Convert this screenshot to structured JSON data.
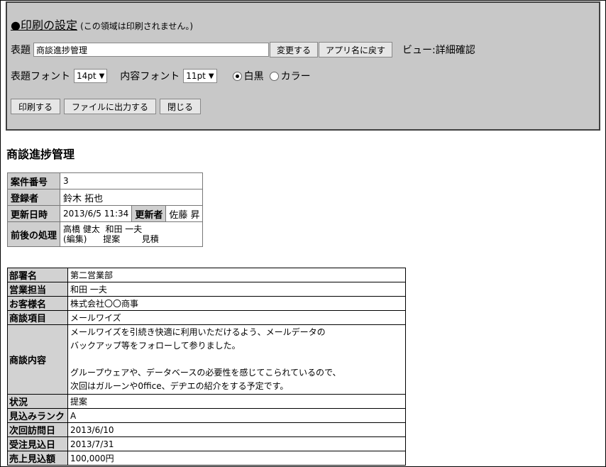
{
  "print_settings": {
    "heading_link": "●印刷の設定",
    "heading_note": "(この領域は印刷されません。)",
    "title_label": "表題",
    "title_value": "商談進捗管理",
    "change_button": "変更する",
    "reset_button": "アプリ名に戻す",
    "view_label": "ビュー:詳細確認",
    "title_font_label": "表題フォント",
    "title_font_value": "14pt",
    "content_font_label": "内容フォント",
    "content_font_value": "11pt",
    "mono_label": "白黒",
    "color_label": "カラー",
    "print_button": "印刷する",
    "export_button": "ファイルに出力する",
    "close_button": "閉じる"
  },
  "page_title": "商談進捗管理",
  "record_info": {
    "case_no_label": "案件番号",
    "case_no": "3",
    "registrant_label": "登録者",
    "registrant": "鈴木 拓也",
    "updated_at_label": "更新日時",
    "updated_at": "2013/6/5 11:34",
    "updater_label": "更新者",
    "updater": "佐藤 昇",
    "process_label": "前後の処理",
    "process_value": "高橋 健太  和田 一夫\n(編集)      提案        見積"
  },
  "details": [
    {
      "label": "部署名",
      "value": "第二営業部"
    },
    {
      "label": "営業担当",
      "value": "和田 一夫"
    },
    {
      "label": "お客様名",
      "value": "株式会社〇〇商事"
    },
    {
      "label": "商談項目",
      "value": "メールワイズ"
    },
    {
      "label": "商談内容",
      "value": "メールワイズを引続き快適に利用いただけるよう、メールデータの\nバックアップ等をフォローして参りました。\n\nグループウェアや、データベースの必要性を感じてこられているので、\n次回はガルーンや0ffice、デヂエの紹介をする予定です。"
    },
    {
      "label": "状況",
      "value": "提案"
    },
    {
      "label": "見込みランク",
      "value": "A"
    },
    {
      "label": "次回訪問日",
      "value": "2013/6/10"
    },
    {
      "label": "受注見込日",
      "value": "2013/7/31"
    },
    {
      "label": "売上見込額",
      "value": "100,000円"
    }
  ]
}
